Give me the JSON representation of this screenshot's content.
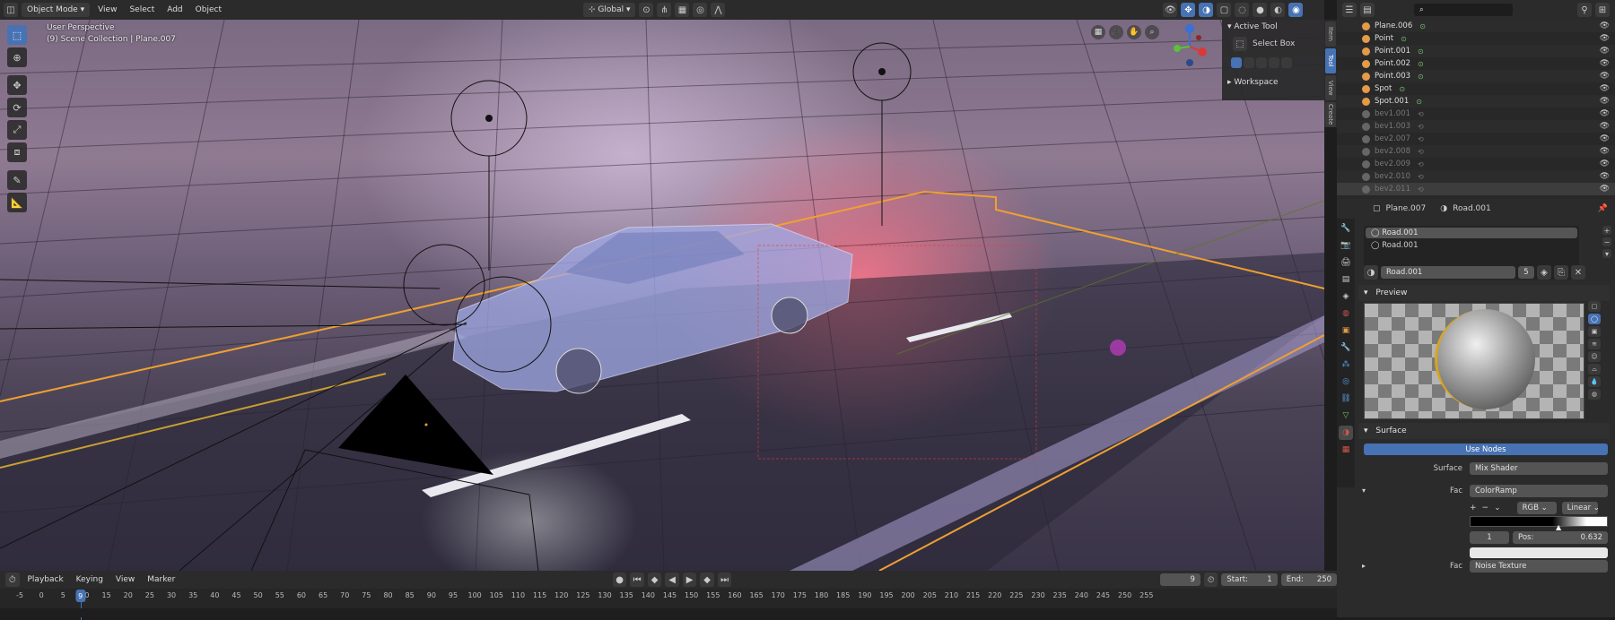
{
  "viewport_header": {
    "editor_icon": "viewport-editor-icon",
    "mode": "Object Mode",
    "menus": [
      "View",
      "Select",
      "Add",
      "Object"
    ],
    "transform_orientation": "Global"
  },
  "viewport": {
    "perspective_label": "User Perspective",
    "collection_label": "(9) Scene Collection | Plane.007"
  },
  "npanel": {
    "active_tool_header": "Active Tool",
    "tool_name": "Select Box",
    "workspace_header": "Workspace",
    "tabs": [
      "Item",
      "Tool",
      "View",
      "Create"
    ]
  },
  "outliner": {
    "rows": [
      {
        "label": "Plane.006",
        "dim": false
      },
      {
        "label": "Point",
        "dim": false
      },
      {
        "label": "Point.001",
        "dim": false
      },
      {
        "label": "Point.002",
        "dim": false
      },
      {
        "label": "Point.003",
        "dim": false
      },
      {
        "label": "Spot",
        "dim": false
      },
      {
        "label": "Spot.001",
        "dim": false
      },
      {
        "label": "bev1.001",
        "dim": true
      },
      {
        "label": "bev1.003",
        "dim": true
      },
      {
        "label": "bev2.007",
        "dim": true
      },
      {
        "label": "bev2.008",
        "dim": true
      },
      {
        "label": "bev2.009",
        "dim": true
      },
      {
        "label": "bev2.010",
        "dim": true
      },
      {
        "label": "bev2.011",
        "dim": true
      }
    ]
  },
  "properties": {
    "object_name": "Plane.007",
    "material_name": "Road.001",
    "slots": [
      "Road.001",
      "Road.001"
    ],
    "material_field": "Road.001",
    "user_count": "5",
    "preview_header": "Preview",
    "surface_header": "Surface",
    "use_nodes_label": "Use Nodes",
    "surface_label": "Surface",
    "surface_value": "Mix Shader",
    "fac_label": "Fac",
    "fac_value": "ColorRamp",
    "color_mode": "RGB",
    "interpolation": "Linear",
    "stop_index": "1",
    "pos_label": "Pos:",
    "pos_value": "0.632",
    "fac2_label": "Fac",
    "fac2_value": "Noise Texture"
  },
  "timeline": {
    "menus": [
      "Playback",
      "Keying",
      "View",
      "Marker"
    ],
    "current_frame": "9",
    "start_label": "Start:",
    "start_value": "1",
    "end_label": "End:",
    "end_value": "250",
    "ruler": [
      "-5",
      "0",
      "5",
      "10",
      "15",
      "20",
      "25",
      "30",
      "35",
      "40",
      "45",
      "50",
      "55",
      "60",
      "65",
      "70",
      "75",
      "80",
      "85",
      "90",
      "95",
      "100",
      "105",
      "110",
      "115",
      "120",
      "125",
      "130",
      "135",
      "140",
      "145",
      "150",
      "155",
      "160",
      "165",
      "170",
      "175",
      "180",
      "185",
      "190",
      "195",
      "200",
      "205",
      "210",
      "215",
      "220",
      "225",
      "230",
      "235",
      "240",
      "245",
      "250",
      "255"
    ],
    "ruler_current": "9"
  }
}
